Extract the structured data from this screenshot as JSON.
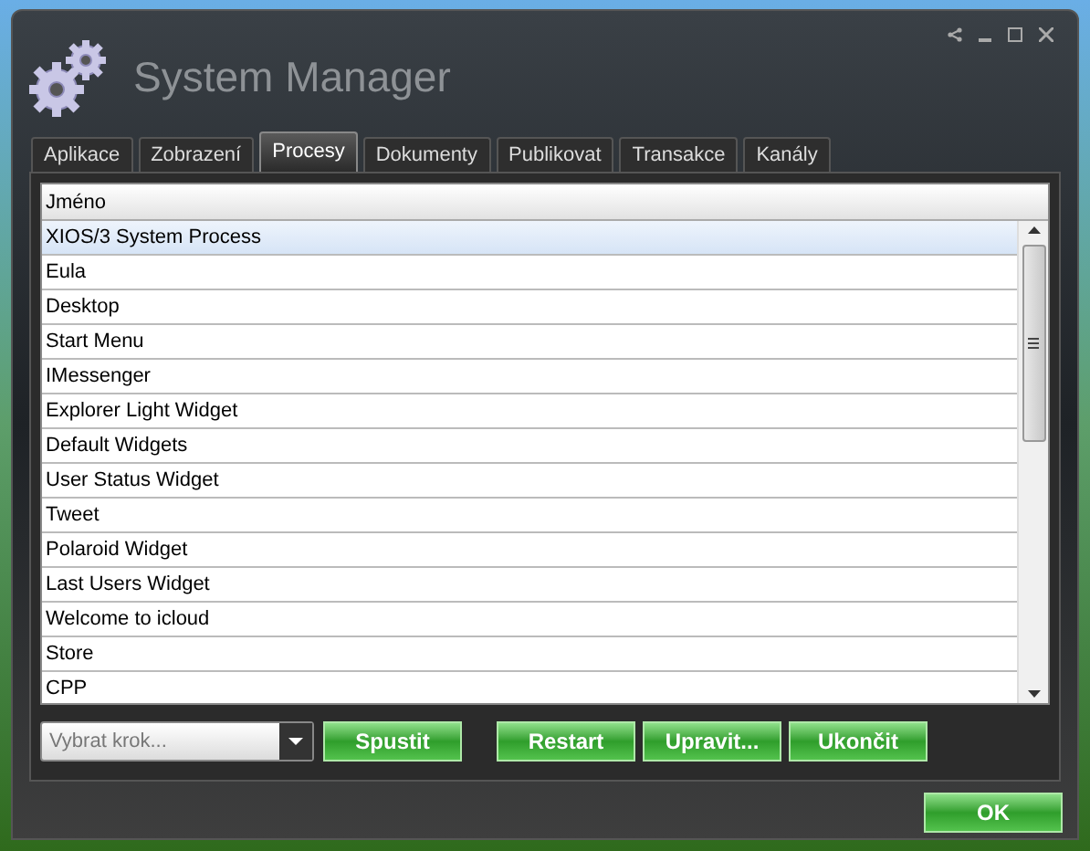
{
  "window": {
    "title": "System Manager"
  },
  "tabs": [
    {
      "label": "Aplikace",
      "selected": false
    },
    {
      "label": "Zobrazení",
      "selected": false
    },
    {
      "label": "Procesy",
      "selected": true
    },
    {
      "label": "Dokumenty",
      "selected": false
    },
    {
      "label": "Publikovat",
      "selected": false
    },
    {
      "label": "Transakce",
      "selected": false
    },
    {
      "label": "Kanály",
      "selected": false
    }
  ],
  "table": {
    "columns": [
      "Jméno"
    ],
    "rows": [
      {
        "name": "XIOS/3 System Process",
        "selected": true
      },
      {
        "name": "Eula",
        "selected": false
      },
      {
        "name": "Desktop",
        "selected": false
      },
      {
        "name": "Start Menu",
        "selected": false
      },
      {
        "name": "IMessenger",
        "selected": false
      },
      {
        "name": "Explorer Light Widget",
        "selected": false
      },
      {
        "name": "Default Widgets",
        "selected": false
      },
      {
        "name": "User Status Widget",
        "selected": false
      },
      {
        "name": "Tweet",
        "selected": false
      },
      {
        "name": "Polaroid Widget",
        "selected": false
      },
      {
        "name": "Last Users Widget",
        "selected": false
      },
      {
        "name": "Welcome to icloud",
        "selected": false
      },
      {
        "name": "Store",
        "selected": false
      },
      {
        "name": "CPP",
        "selected": false
      }
    ]
  },
  "step_select": {
    "placeholder": "Vybrat krok..."
  },
  "actions": [
    "Spustit",
    "Restart",
    "Upravit...",
    "Ukončit"
  ],
  "ok_button": "OK"
}
